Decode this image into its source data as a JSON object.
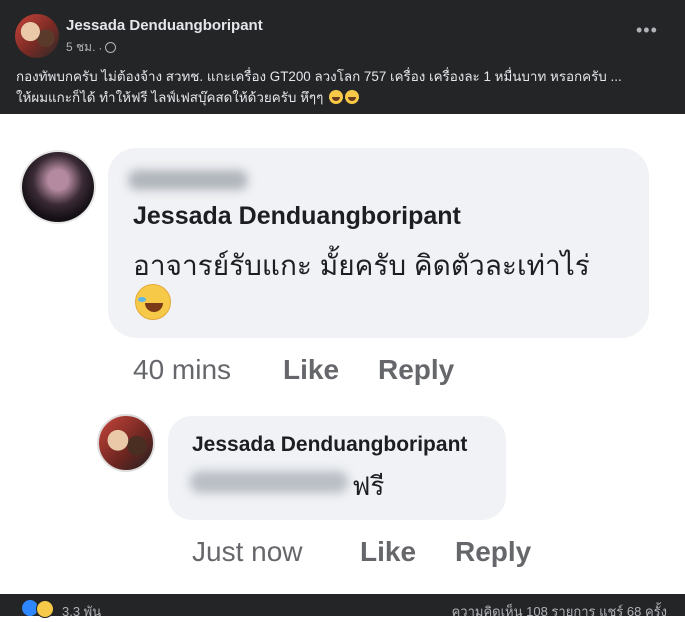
{
  "post": {
    "author": "Jessada Denduangboripant",
    "time": "5 ชม.",
    "separator": "·",
    "more": "•••",
    "text": "กองทัพบกครับ ไม่ต้องจ้าง สวทช. แกะเครื่อง GT200 ลวงโลก 757 เครื่อง เครื่องละ 1 หมื่นบาท หรอกครับ ...\nให้ผมแกะก็ได้ ทำให้ฟรี ไลฟ์เฟสบุ๊คสดให้ด้วยครับ หึๆๆ",
    "icons": [
      "globe-icon",
      "grinning-emoji",
      "grinning-emoji"
    ]
  },
  "comments": [
    {
      "author": "Jessada Denduangboripant",
      "text": "อาจารย์รับแกะ มั้ยครับ คิดตัวละเท่าไร่",
      "emoji": "rolling-laughing-emoji",
      "time": "40 mins",
      "like": "Like",
      "reply": "Reply"
    },
    {
      "author": "Jessada Denduangboripant",
      "text": "ฟรี",
      "time": "Just now",
      "like": "Like",
      "reply": "Reply"
    }
  ],
  "footer": {
    "reactions": "3.3 พัน",
    "stats": "ความคิดเห็น 108 รายการ  แชร์ 68 ครั้ง",
    "reaction_icons": [
      "like-icon",
      "haha-icon"
    ]
  },
  "colors": {
    "dark_bg": "#242526",
    "bubble": "#f0f2f5",
    "muted_text": "#65676b"
  }
}
